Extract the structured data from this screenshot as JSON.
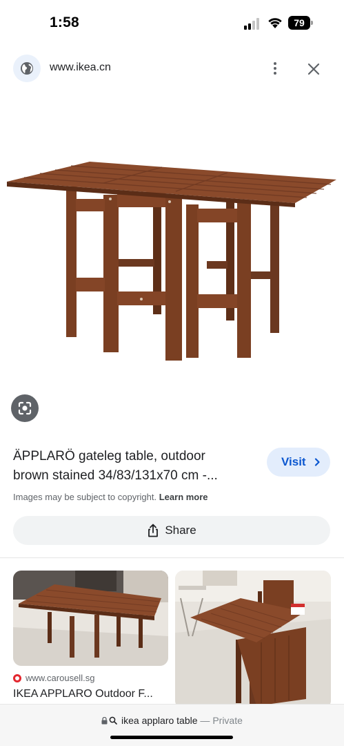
{
  "status_bar": {
    "time": "1:58",
    "battery_level": "79"
  },
  "header": {
    "url": "www.ikea.cn"
  },
  "result": {
    "title_line1": "ÄPPLARÖ gateleg table, outdoor",
    "title_line2": "brown stained 34/83/131x70 cm -...",
    "visit_label": "Visit",
    "copyright_text": "Images may be subject to copyright.",
    "learn_more": "Learn more",
    "share_label": "Share"
  },
  "related": [
    {
      "source": "www.carousell.sg",
      "title": "IKEA APPLARO Outdoor F..."
    },
    {
      "source": "",
      "title": ""
    }
  ],
  "bottom_bar": {
    "query": "ikea applaro table",
    "separator": "—",
    "mode": "Private"
  },
  "colors": {
    "wood": "#7a3f22",
    "visit_blue": "#0b57d0",
    "visit_bg": "#e3edfc"
  },
  "icons": [
    "globe-icon",
    "more-vert-icon",
    "close-icon",
    "lens-icon",
    "chevron-right-icon",
    "share-icon",
    "lock-icon",
    "search-icon"
  ]
}
